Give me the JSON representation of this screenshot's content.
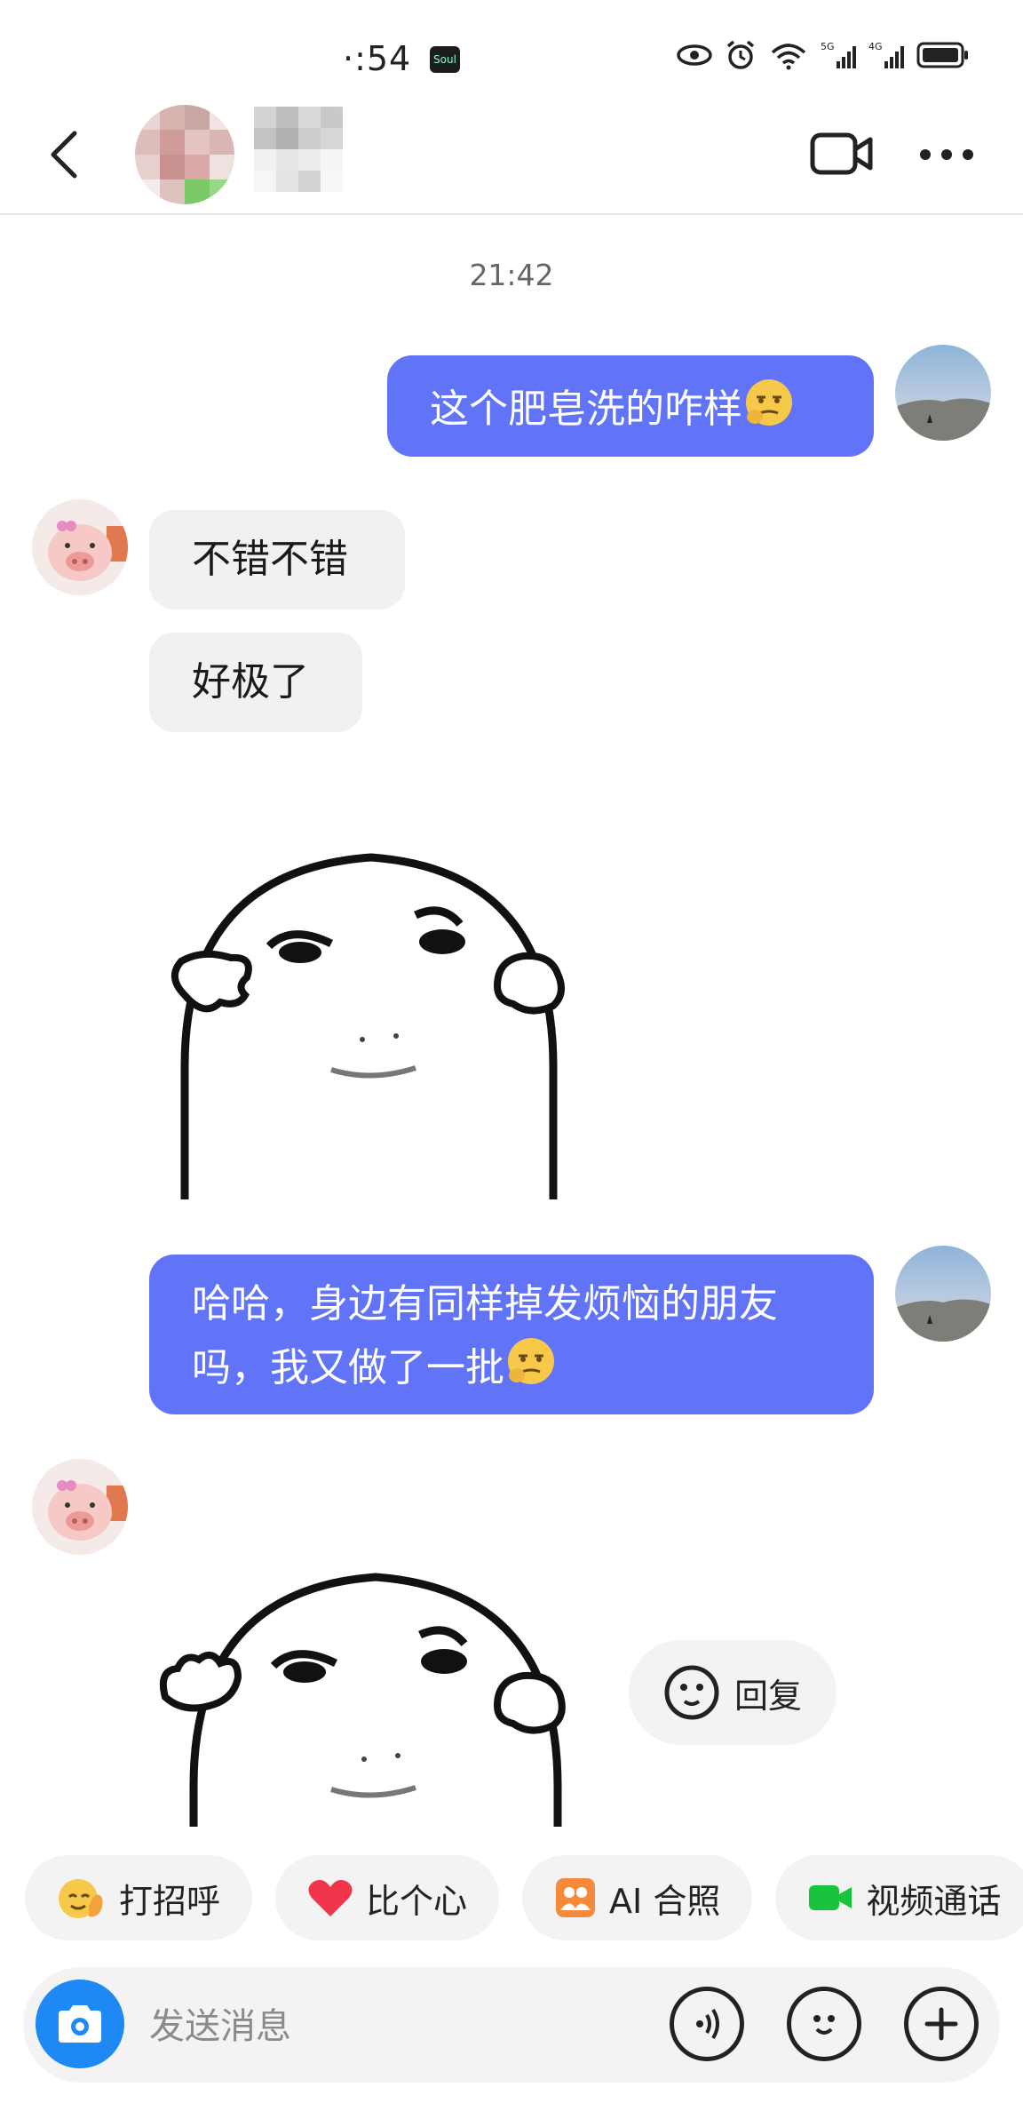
{
  "status_bar": {
    "time": "·:54",
    "app_badge": "Soul"
  },
  "header": {
    "contact_name": ""
  },
  "chat": {
    "timestamp": "21:42",
    "messages": [
      {
        "from": "me",
        "text": "这个肥皂洗的咋样"
      },
      {
        "from": "them",
        "text": "不错不错"
      },
      {
        "from": "them",
        "text": "好极了"
      },
      {
        "from": "me",
        "text_line1": "哈哈，身边有同样掉发烦恼的朋友",
        "text_line2": "吗，我又做了一批"
      }
    ],
    "reply_label": "回复"
  },
  "quick_actions": [
    {
      "label": "打招呼",
      "icon": "wave-hand-icon"
    },
    {
      "label": "比个心",
      "icon": "heart-icon"
    },
    {
      "label": "AI 合照",
      "icon": "ai-photo-icon"
    },
    {
      "label": "视频通话",
      "icon": "video-call-icon"
    }
  ],
  "input": {
    "placeholder": "发送消息"
  },
  "colors": {
    "my_bubble": "#6173f7",
    "their_bubble": "#f1f1f1",
    "camera_button": "#1e88f5"
  }
}
